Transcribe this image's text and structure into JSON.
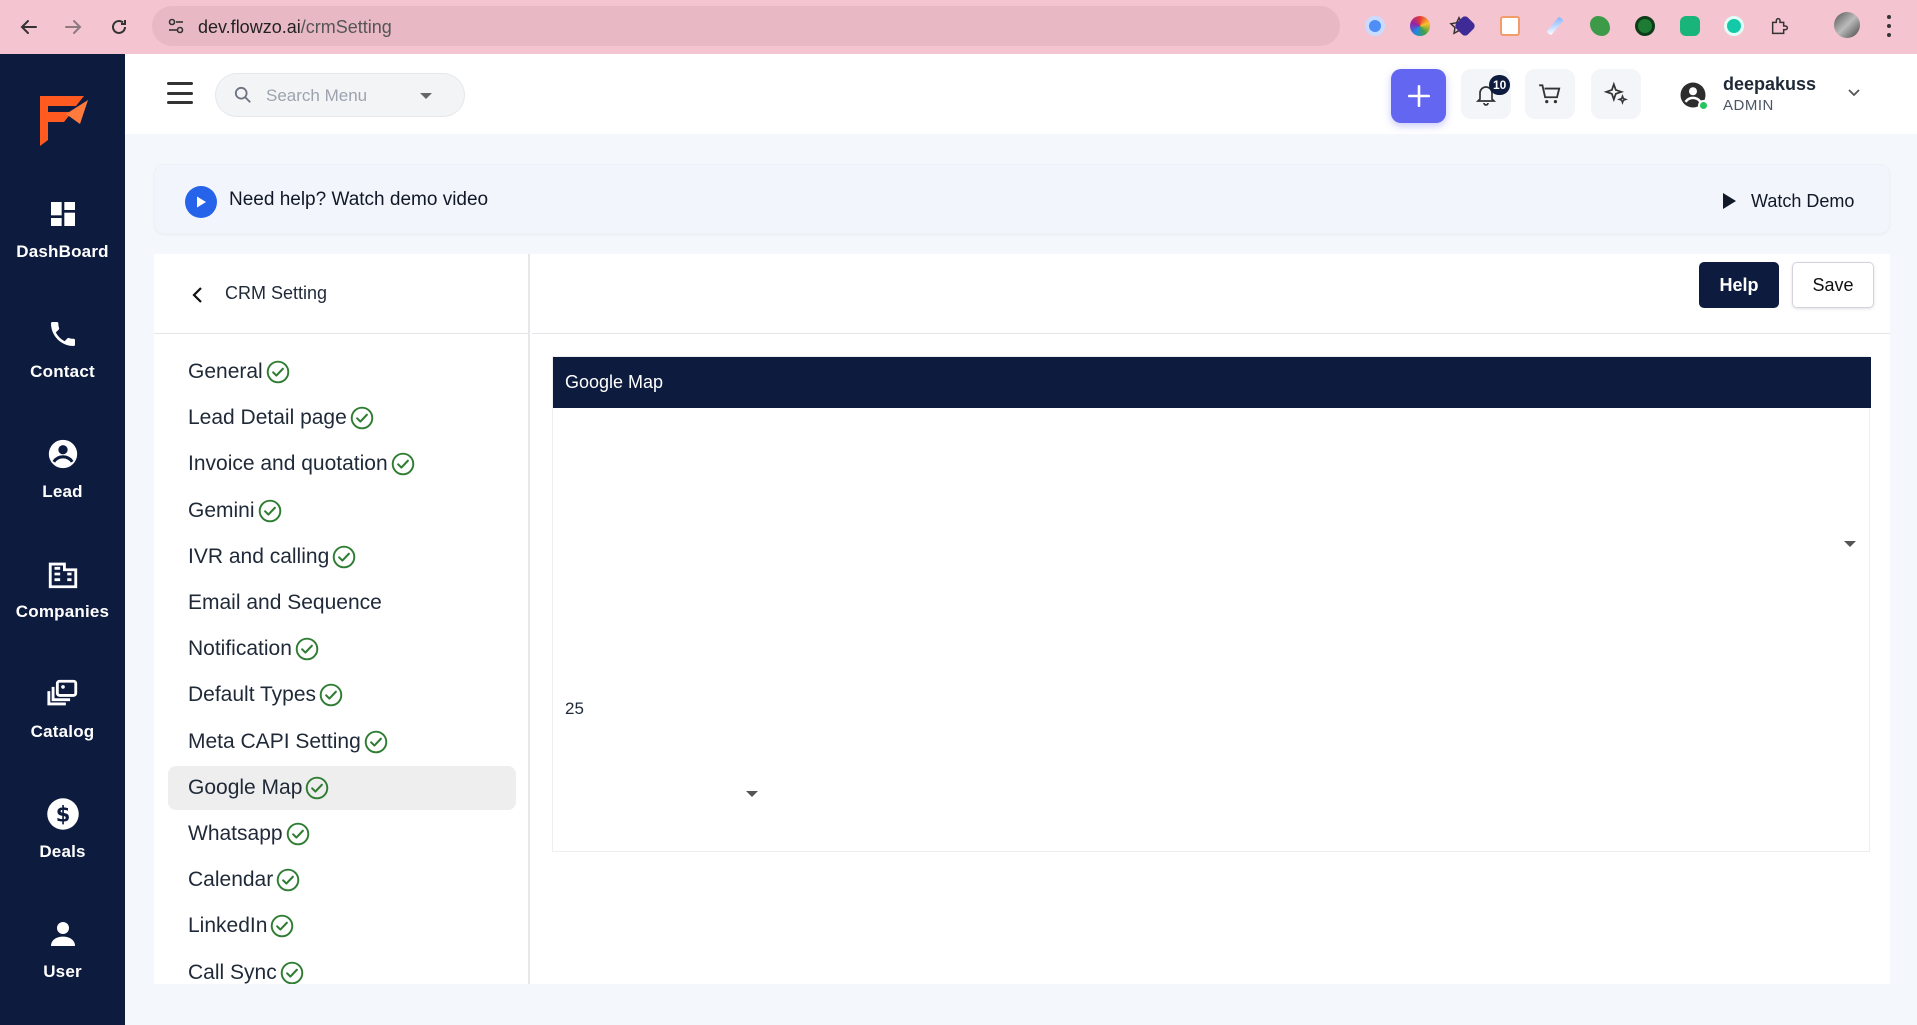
{
  "browser": {
    "url_host": "dev.flowzo.ai",
    "url_path": "/crmSetting"
  },
  "sidebar": {
    "items": [
      {
        "label": "DashBoard",
        "icon": "dashboard-icon"
      },
      {
        "label": "Contact",
        "icon": "phone-icon"
      },
      {
        "label": "Lead",
        "icon": "person-circle-icon"
      },
      {
        "label": "Companies",
        "icon": "companies-icon"
      },
      {
        "label": "Catalog",
        "icon": "catalog-icon"
      },
      {
        "label": "Deals",
        "icon": "dollar-icon"
      },
      {
        "label": "User",
        "icon": "user-icon"
      }
    ]
  },
  "header": {
    "search_placeholder": "Search Menu",
    "notifications_count": "10",
    "user_name": "deepakuss",
    "user_role": "ADMIN"
  },
  "help_banner": {
    "text": "Need help? Watch demo video",
    "watch_demo": "Watch Demo"
  },
  "settings": {
    "title": "CRM Setting",
    "help_button": "Help",
    "save_button": "Save",
    "menu": [
      {
        "label": "General",
        "checked": true
      },
      {
        "label": "Lead Detail page",
        "checked": true
      },
      {
        "label": "Invoice and quotation",
        "checked": true
      },
      {
        "label": "Gemini",
        "checked": true
      },
      {
        "label": "IVR and calling",
        "checked": true
      },
      {
        "label": "Email and Sequence",
        "checked": false
      },
      {
        "label": "Notification",
        "checked": true
      },
      {
        "label": "Default Types",
        "checked": true
      },
      {
        "label": "Meta CAPI Setting",
        "checked": true
      },
      {
        "label": "Google Map",
        "checked": true,
        "active": true
      },
      {
        "label": "Whatsapp",
        "checked": true
      },
      {
        "label": "Calendar",
        "checked": true
      },
      {
        "label": "LinkedIn",
        "checked": true
      },
      {
        "label": "Call Sync",
        "checked": true
      }
    ],
    "section_title": "Google Map",
    "zoom_value": "25"
  },
  "colors": {
    "navy": "#0d1b3e",
    "accent": "#6366f1",
    "check_green": "#2e7d32",
    "chrome_pink": "#f4c4d0"
  }
}
